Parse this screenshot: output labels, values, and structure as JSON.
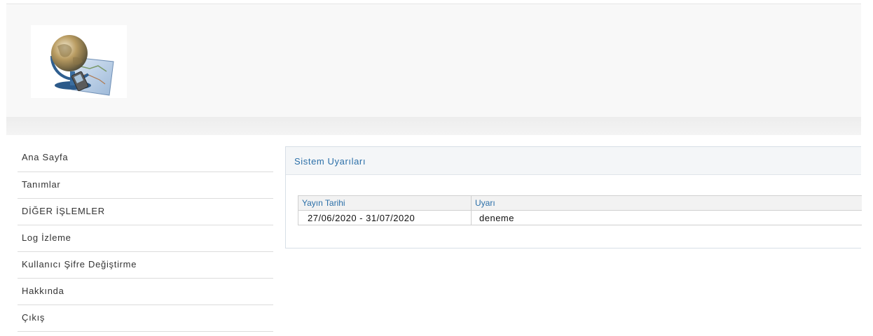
{
  "nav": {
    "items": [
      {
        "label": "Ana Sayfa"
      },
      {
        "label": "Tanımlar"
      },
      {
        "label": "DİĞER İŞLEMLER"
      },
      {
        "label": "Log İzleme"
      },
      {
        "label": "Kullanıcı Şifre Değiştirme"
      },
      {
        "label": "Hakkında"
      },
      {
        "label": "Çıkış"
      }
    ]
  },
  "panel": {
    "title": "Sistem Uyarıları",
    "table": {
      "headers": [
        "Yayın Tarihi",
        "Uyarı"
      ],
      "rows": [
        [
          "27/06/2020 - 31/07/2020",
          "deneme"
        ]
      ]
    }
  },
  "colors": {
    "accent": "#2b6fa8",
    "header_bg": "#f8f8f8",
    "border": "#dcdcdc"
  }
}
